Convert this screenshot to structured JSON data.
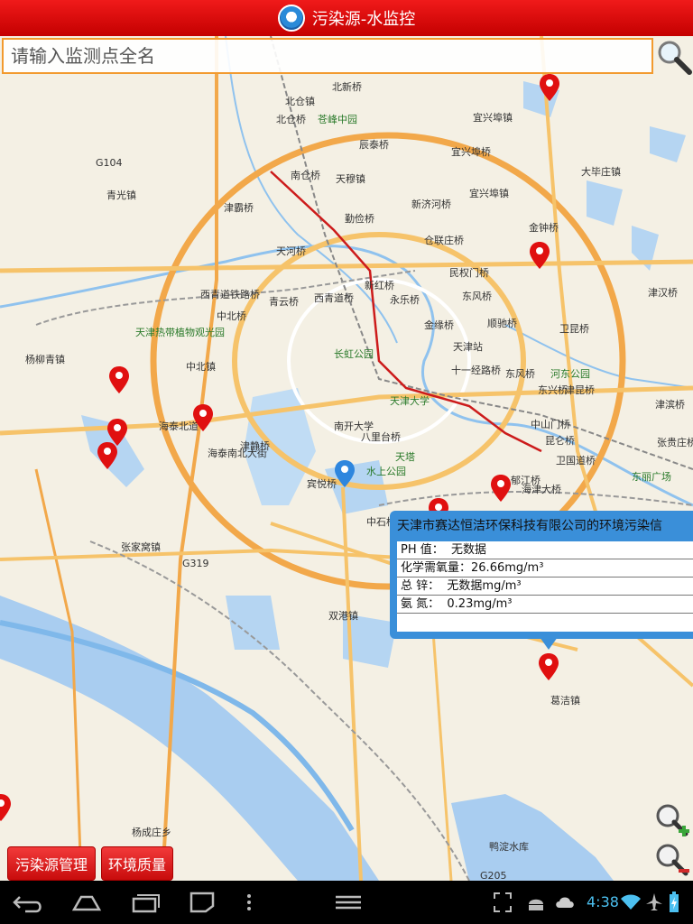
{
  "app": {
    "title": "污染源-水监控"
  },
  "search": {
    "placeholder": "请输入监测点全名"
  },
  "map": {
    "labels": [
      {
        "text": "北新桥"
      },
      {
        "text": "北仓镇"
      },
      {
        "text": "北仓桥"
      },
      {
        "text": "苍峰中园"
      },
      {
        "text": "宜兴埠镇"
      },
      {
        "text": "宜兴埠桥"
      },
      {
        "text": "辰泰桥"
      },
      {
        "text": "南仓桥"
      },
      {
        "text": "天穆镇"
      },
      {
        "text": "大毕庄镇"
      },
      {
        "text": "青光镇"
      },
      {
        "text": "津霸桥"
      },
      {
        "text": "勤俭桥"
      },
      {
        "text": "新济河桥"
      },
      {
        "text": "宜兴埠镇"
      },
      {
        "text": "金钟桥"
      },
      {
        "text": "天河桥"
      },
      {
        "text": "仓联庄桥"
      },
      {
        "text": "民权门桥"
      },
      {
        "text": "西青道铁路桥"
      },
      {
        "text": "青云桥"
      },
      {
        "text": "西青道桥"
      },
      {
        "text": "新红桥"
      },
      {
        "text": "永乐桥"
      },
      {
        "text": "东风桥"
      },
      {
        "text": "津汉桥"
      },
      {
        "text": "中北桥"
      },
      {
        "text": "天津热带植物观光园"
      },
      {
        "text": "金缘桥"
      },
      {
        "text": "顺驰桥"
      },
      {
        "text": "卫昆桥"
      },
      {
        "text": "杨柳青镇"
      },
      {
        "text": "长虹公园"
      },
      {
        "text": "天津站"
      },
      {
        "text": "中北镇"
      },
      {
        "text": "十一经路桥"
      },
      {
        "text": "东风桥"
      },
      {
        "text": "河东公园"
      },
      {
        "text": "天津大学"
      },
      {
        "text": "东兴桥"
      },
      {
        "text": "津昆桥"
      },
      {
        "text": "海泰北道"
      },
      {
        "text": "南开大学"
      },
      {
        "text": "中山门桥"
      },
      {
        "text": "津滨桥"
      },
      {
        "text": "津静桥"
      },
      {
        "text": "八里台桥"
      },
      {
        "text": "昆仑桥"
      },
      {
        "text": "张贵庄桥"
      },
      {
        "text": "天塔"
      },
      {
        "text": "水上公园"
      },
      {
        "text": "卫国道桥"
      },
      {
        "text": "东丽广场"
      },
      {
        "text": "郁江桥"
      },
      {
        "text": "海津大桥"
      },
      {
        "text": "宾悦桥"
      },
      {
        "text": "张家窝镇"
      },
      {
        "text": "中石桥"
      },
      {
        "text": "双港镇"
      },
      {
        "text": "杨成庄乡"
      },
      {
        "text": "鸭淀水库"
      },
      {
        "text": "葛洁镇"
      },
      {
        "text": "海泰南北大街"
      },
      {
        "text": "G104"
      },
      {
        "text": "G319"
      },
      {
        "text": "G205"
      }
    ]
  },
  "popup": {
    "title": "天津市赛达恒洁环保科技有限公司的环境污染信",
    "rows": [
      {
        "label": "PH 值：",
        "value": "无数据"
      },
      {
        "label": "化学需氧量：",
        "value": "26.66mg/m³"
      },
      {
        "label": "总 锌：",
        "value": "无数据mg/m³"
      },
      {
        "label": "氨 氮：",
        "value": "0.23mg/m³"
      }
    ]
  },
  "buttons": {
    "pollution_mgmt": "污染源管理",
    "env_quality": "环境质量"
  },
  "status": {
    "time": "4:38"
  },
  "colors": {
    "titlebar": "#e00000",
    "accent_orange": "#f29a2e",
    "popup_blue": "#3a8fd9",
    "marker_red": "#e01010",
    "marker_blue": "#2e86de"
  }
}
